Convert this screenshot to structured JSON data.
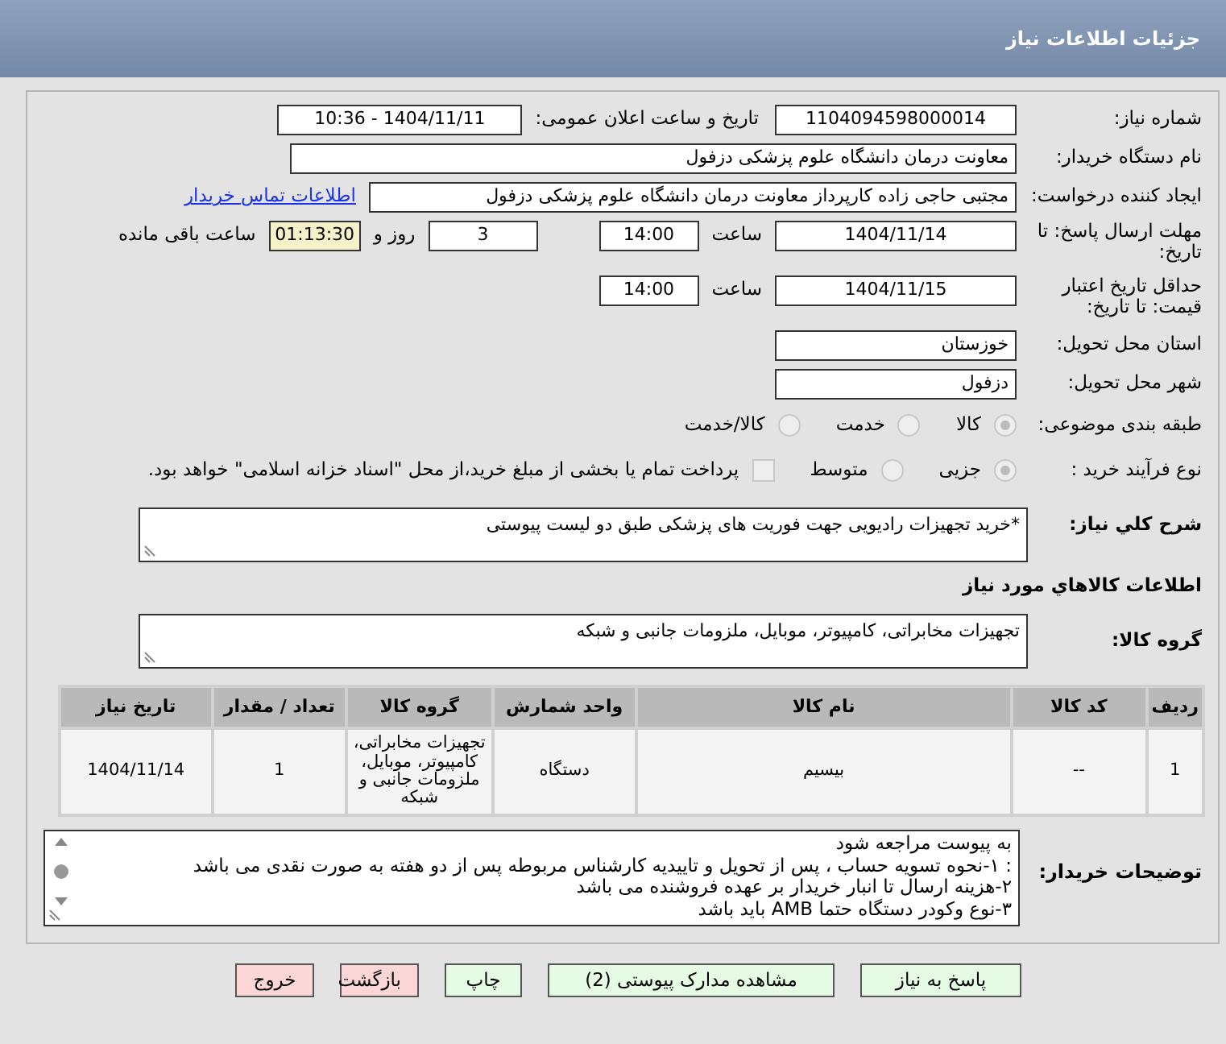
{
  "title": "جزئیات اطلاعات نیاز",
  "need_number": {
    "label": "شماره نیاز:",
    "value": "1104094598000014"
  },
  "announce": {
    "label": "تاریخ و ساعت اعلان عمومی:",
    "value": "1404/11/11 - 10:36"
  },
  "buyer_org": {
    "label": "نام دستگاه خریدار:",
    "value": "معاونت درمان دانشگاه علوم پزشکی دزفول"
  },
  "requester": {
    "label": "ایجاد کننده درخواست:",
    "value": "مجتبی حاجی زاده کارپرداز معاونت درمان دانشگاه علوم پزشکی دزفول",
    "link": "اطلاعات تماس خریدار"
  },
  "deadline": {
    "label": "مهلت ارسال پاسخ: تا تاریخ:",
    "date": "1404/11/14",
    "time_label": "ساعت",
    "time": "14:00",
    "days": "3",
    "days_label": "روز و",
    "remaining": "01:13:30",
    "remaining_label": "ساعت باقی مانده"
  },
  "validity": {
    "label": "حداقل تاریخ اعتبار قیمت: تا تاریخ:",
    "date": "1404/11/15",
    "time_label": "ساعت",
    "time": "14:00"
  },
  "province": {
    "label": "استان محل تحویل:",
    "value": "خوزستان"
  },
  "city": {
    "label": "شهر محل تحویل:",
    "value": "دزفول"
  },
  "category": {
    "label": "طبقه بندی موضوعی:",
    "options": [
      {
        "label": "کالا",
        "selected": true
      },
      {
        "label": "خدمت",
        "selected": false
      },
      {
        "label": "کالا/خدمت",
        "selected": false
      }
    ]
  },
  "process": {
    "label": "نوع فرآیند خرید :",
    "options": [
      {
        "label": "جزیی",
        "selected": true
      },
      {
        "label": "متوسط",
        "selected": false
      }
    ],
    "treasury": {
      "label": "پرداخت تمام یا بخشی از مبلغ خرید،از محل \"اسناد خزانه اسلامی\" خواهد بود.",
      "checked": false
    }
  },
  "description": {
    "label": "شرح کلي نياز:",
    "value": "*خرید تجهیزات رادیویی جهت فوریت های پزشکی طبق دو لیست پیوستی"
  },
  "goods_heading": "اطلاعات کالاهاي مورد نياز",
  "goods_group": {
    "label": "گروه کالا:",
    "value": "تجهیزات مخابراتی، کامپیوتر، موبایل، ملزومات جانبی و شبکه"
  },
  "table": {
    "columns": [
      "ردیف",
      "کد کالا",
      "نام کالا",
      "واحد شمارش",
      "گروه کالا",
      "تعداد / مقدار",
      "تاریخ نیاز"
    ],
    "rows": [
      [
        "1",
        "--",
        "بیسیم",
        "دستگاه",
        "تجهیزات مخابراتی، کامپیوتر، موبایل، ملزومات جانبی و شبکه",
        "1",
        "1404/11/14"
      ]
    ]
  },
  "notes": {
    "label": "توضیحات خریدار:",
    "lines": [
      "به پیوست مراجعه شود",
      ": ۱-نحوه تسویه حساب ، پس از تحویل و تاییدیه کارشناس مربوطه پس از دو هفته به صورت نقدی می باشد",
      "۲-هزینه ارسال تا انبار خریدار بر عهده فروشنده می باشد",
      "۳-نوع وکودر دستگاه حتما AMB باید باشد"
    ]
  },
  "buttons": [
    {
      "label": "پاسخ به نیاز",
      "kind": "action"
    },
    {
      "label": "مشاهده مدارک پیوستی (2)",
      "kind": "action"
    },
    {
      "label": "چاپ",
      "kind": "action"
    },
    {
      "label": "بازگشت",
      "kind": "exit"
    },
    {
      "label": "خروج",
      "kind": "exit"
    }
  ]
}
